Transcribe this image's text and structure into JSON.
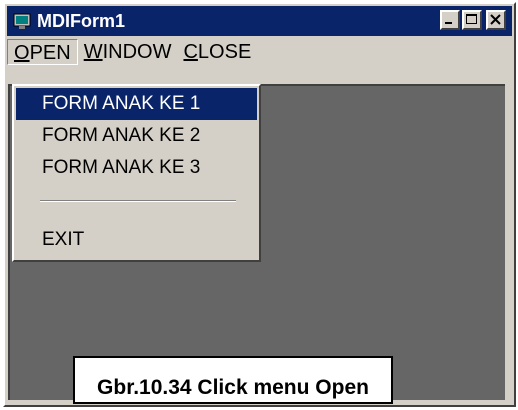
{
  "window": {
    "title": "MDIForm1",
    "icon": "app-icon",
    "controls": [
      "minimize-icon",
      "maximize-icon",
      "close-icon"
    ]
  },
  "menubar": {
    "items": [
      {
        "accel": "O",
        "rest": "PEN",
        "active": true
      },
      {
        "accel": "W",
        "rest": "INDOW",
        "active": false
      },
      {
        "accel": "C",
        "rest": "LOSE",
        "active": false
      }
    ]
  },
  "open_menu": {
    "items": [
      {
        "label": "FORM ANAK KE 1",
        "selected": true
      },
      {
        "label": "FORM ANAK KE 2",
        "selected": false
      },
      {
        "label": "FORM ANAK KE 3",
        "selected": false
      },
      {
        "label": "EXIT",
        "selected": false
      }
    ]
  },
  "caption": "Gbr.10.34 Click menu Open",
  "colors": {
    "titlebar": "#0a246a",
    "face": "#d4d0c8",
    "mdi_client": "#666666",
    "highlight": "#0a246a"
  }
}
